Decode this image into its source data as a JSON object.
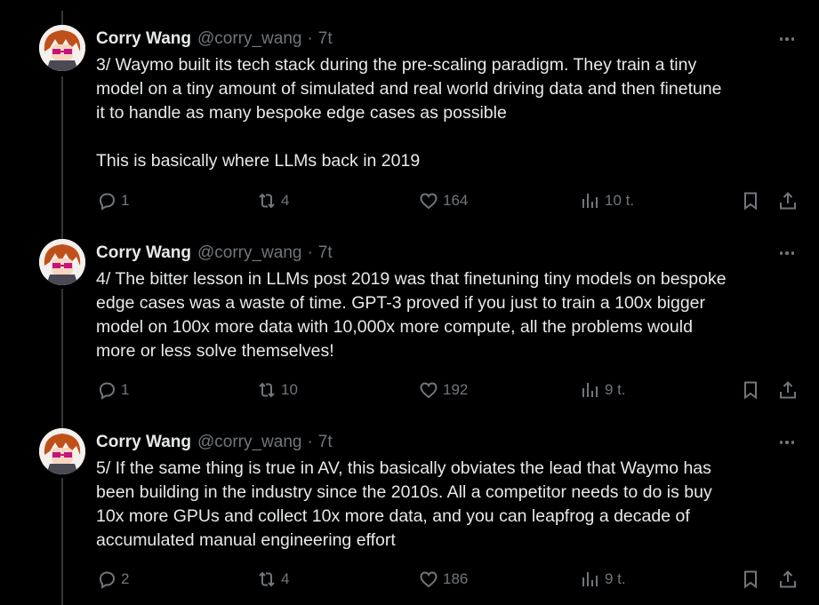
{
  "tweets": [
    {
      "name": "Corry Wang",
      "handle": "@corry_wang",
      "separator": "·",
      "time": "7t",
      "text": "3/ Waymo built its tech stack during the pre-scaling paradigm. They train a tiny\nmodel on a tiny amount of simulated and real world driving data and then finetune\nit to handle as many bespoke edge cases as possible\n\nThis is basically where LLMs back in 2019",
      "replies": "1",
      "reposts": "4",
      "likes": "164",
      "views": "10 t."
    },
    {
      "name": "Corry Wang",
      "handle": "@corry_wang",
      "separator": "·",
      "time": "7t",
      "text": "4/ The bitter lesson in LLMs post 2019 was that finetuning tiny models on bespoke\nedge cases was a waste of time. GPT-3 proved if you just to train a 100x bigger\nmodel on 100x more data with 10,000x more compute, all the problems would\nmore or less solve themselves!",
      "replies": "1",
      "reposts": "10",
      "likes": "192",
      "views": "9 t."
    },
    {
      "name": "Corry Wang",
      "handle": "@corry_wang",
      "separator": "·",
      "time": "7t",
      "text": "5/ If the same thing is true in AV, this basically obviates the lead that Waymo has\nbeen building in the industry since the 2010s. All a competitor needs to do is buy\n10x more GPUs and collect 10x more data, and you can leapfrog a decade of\naccumulated manual engineering effort",
      "replies": "2",
      "reposts": "4",
      "likes": "186",
      "views": "9 t."
    }
  ],
  "colors": {
    "background": "#000000",
    "text": "#e7e9ea",
    "muted": "#71767b",
    "thread_line": "#333639"
  },
  "icons": [
    "reply-icon",
    "repost-icon",
    "like-icon",
    "views-icon",
    "bookmark-icon",
    "share-icon",
    "more-icon"
  ]
}
